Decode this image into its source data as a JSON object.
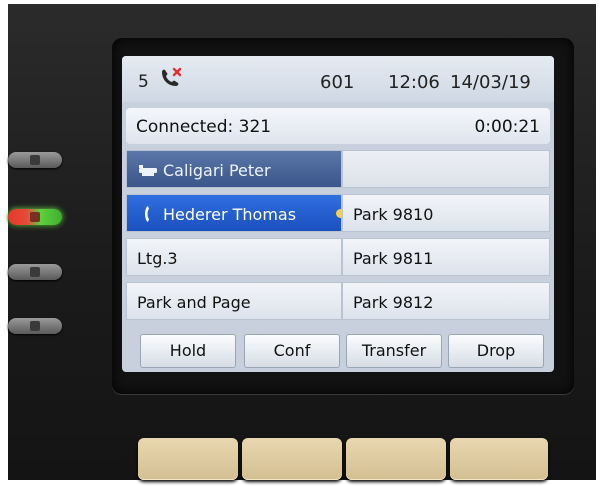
{
  "status": {
    "missed_count": "5",
    "missed_icon": "missed-call-icon",
    "extension": "601",
    "time": "12:06",
    "date": "14/03/19"
  },
  "call": {
    "status": "Connected: 321",
    "timer": "0:00:21"
  },
  "lines": [
    {
      "label": "Caligari Peter",
      "icon": "busy-line-icon",
      "state": "busy"
    },
    {
      "label": "Hederer Thomas",
      "icon": "handset-icon",
      "state": "active"
    },
    {
      "label": "Ltg.3",
      "state": "idle"
    },
    {
      "label": "Park and Page",
      "state": "idle"
    }
  ],
  "park_keys": [
    {
      "label": ""
    },
    {
      "label": "Park 9810"
    },
    {
      "label": "Park 9811"
    },
    {
      "label": "Park 9812"
    }
  ],
  "softkeys": [
    {
      "label": "Hold"
    },
    {
      "label": "Conf"
    },
    {
      "label": "Transfer"
    },
    {
      "label": "Drop"
    }
  ],
  "colors": {
    "selected_line": "#1c50c0",
    "busy_line": "#3a568a",
    "led_red": "#e23a2a",
    "led_green": "#3fb02a"
  }
}
